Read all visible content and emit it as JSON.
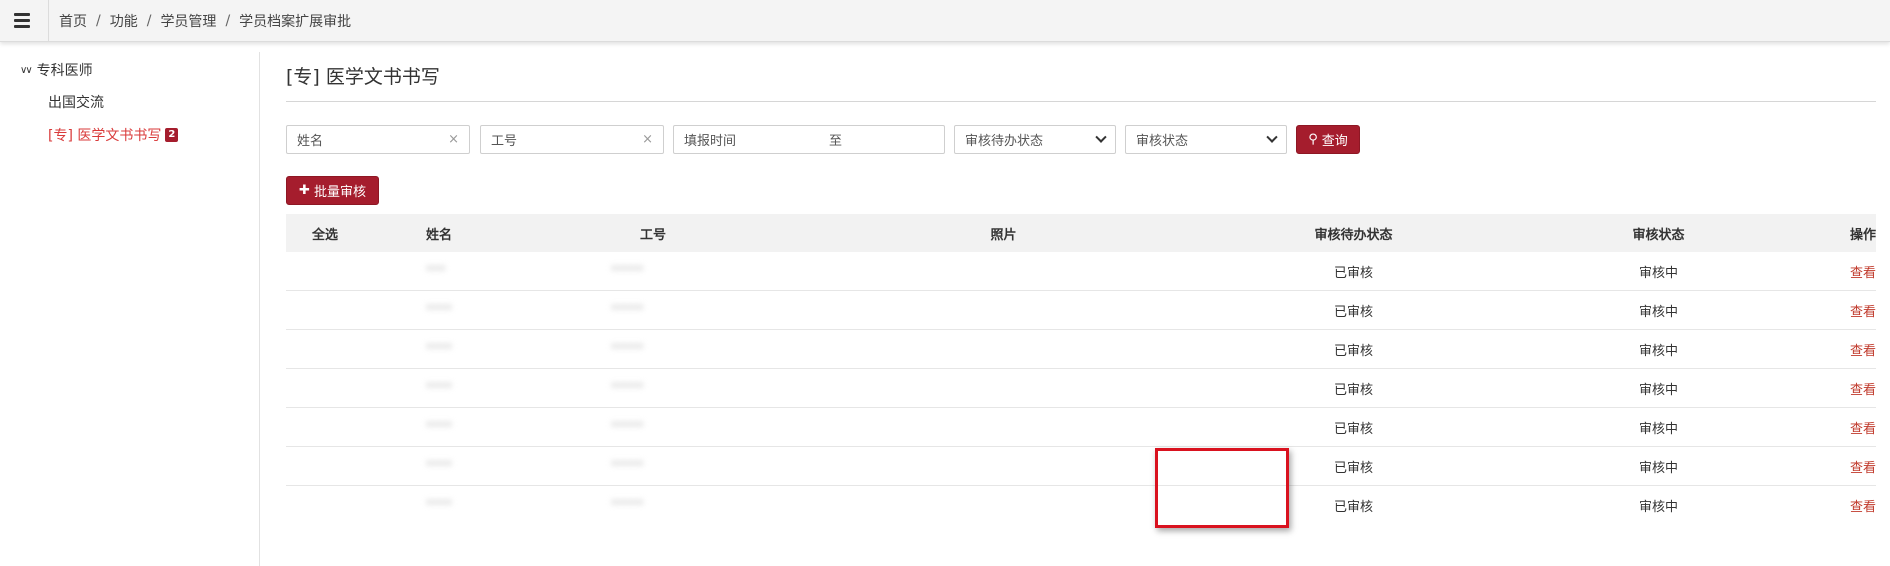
{
  "topbar": {
    "menu_icon": "hamburger-icon",
    "breadcrumb": [
      "首页",
      "功能",
      "学员管理",
      "学员档案扩展审批"
    ],
    "separator": "/"
  },
  "sidebar": {
    "root_label": "专科医师",
    "root_icon": "double-chevron-down-icon",
    "items": [
      {
        "label": "出国交流",
        "active": false
      },
      {
        "label": "[专] 医学文书书写",
        "active": true,
        "badge": "2"
      }
    ]
  },
  "main": {
    "title": "[专] 医学文书书写",
    "filters": {
      "name_placeholder": "姓名",
      "id_placeholder": "工号",
      "date_placeholder": "填报时间",
      "date_to": "至",
      "pending_select": "审核待办状态",
      "status_select": "审核状态",
      "query_label": "查询",
      "clear_symbol": "×"
    },
    "batch_button": "批量审核",
    "table": {
      "headers": [
        "全选",
        "姓名",
        "工号",
        "照片",
        "审核待办状态",
        "审核状态",
        "操作"
      ],
      "rows": [
        {
          "name": "***",
          "id": "*****",
          "pending": "已审核",
          "status": "审核中",
          "action": "查看"
        },
        {
          "name": "****",
          "id": "*****",
          "pending": "已审核",
          "status": "审核中",
          "action": "查看"
        },
        {
          "name": "****",
          "id": "*****",
          "pending": "已审核",
          "status": "审核中",
          "action": "查看"
        },
        {
          "name": "****",
          "id": "*****",
          "pending": "已审核",
          "status": "审核中",
          "action": "查看"
        },
        {
          "name": "****",
          "id": "*****",
          "pending": "已审核",
          "status": "审核中",
          "action": "查看"
        },
        {
          "name": "****",
          "id": "*****",
          "pending": "已审核",
          "status": "审核中",
          "action": "查看"
        },
        {
          "name": "****",
          "id": "*****",
          "pending": "已审核",
          "status": "审核中",
          "action": "查看"
        }
      ]
    }
  },
  "colors": {
    "brand": "#a51d2d",
    "active_link": "#d93a3a",
    "highlight": "#d9121f"
  }
}
